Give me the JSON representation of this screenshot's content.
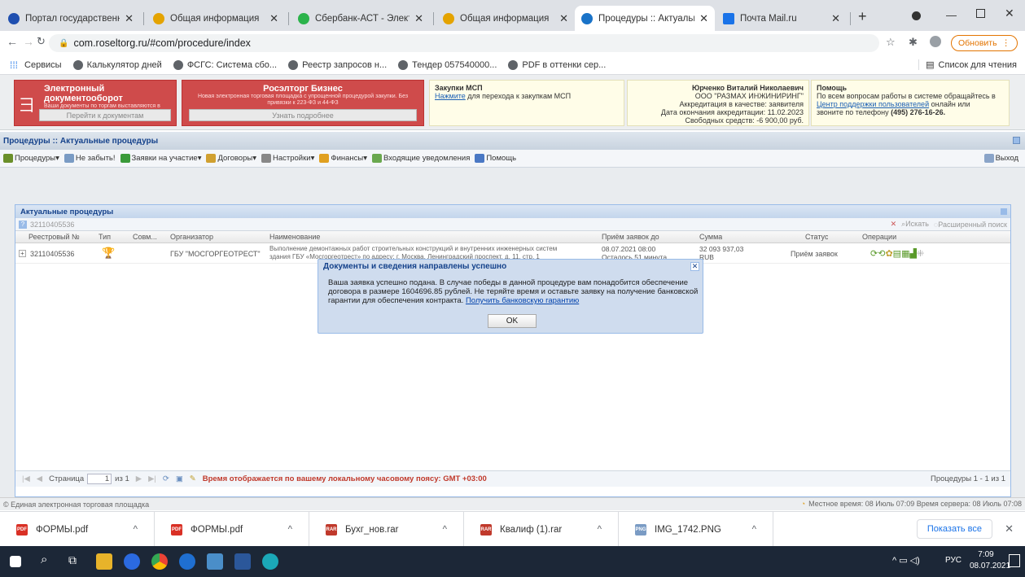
{
  "tabs": [
    {
      "title": "Портал государственных у",
      "color": "#1f4fb0",
      "active": false
    },
    {
      "title": "Общая информация",
      "color": "#e4a300",
      "active": false
    },
    {
      "title": "Сбербанк-АСТ - Электрон",
      "color": "#2bb34b",
      "active": false
    },
    {
      "title": "Общая информация",
      "color": "#e4a300",
      "active": false
    },
    {
      "title": "Процедуры :: Актуальные",
      "color": "#1a73c8",
      "active": true
    },
    {
      "title": "Почта Mail.ru",
      "color": "#1a73e8",
      "active": false
    }
  ],
  "browser": {
    "url": "com.roseltorg.ru/#com/procedure/index",
    "update_btn": "Обновить",
    "new_tab": "+"
  },
  "bookmarks": [
    "Сервисы",
    "Калькулятор дней",
    "ФСГС: Система сбо...",
    "Реестр запросов н...",
    "Тендер 057540000...",
    "PDF в оттенки сер..."
  ],
  "reading_list": "Список для чтения",
  "header": {
    "edo": {
      "title": "Электронный документооборот",
      "sub": "Ваши документы по торгам выставляются в электронном виде",
      "btn": "Перейти к документам"
    },
    "biz": {
      "title": "Росэлторг Бизнес",
      "sub": "Новая электронная торговая площадка с упрощенной процедурой закупки. Без привязки к 223-ФЗ и 44-ФЗ",
      "btn": "Узнать подробнее"
    },
    "msp": {
      "title": "Закупки МСП",
      "link": "Нажмите",
      "text": "для перехода к закупкам МСП"
    },
    "user": {
      "name": "Юрченко Виталий Николаевич",
      "org": "ООО \"РАЗМАХ ИНЖИНИРИНГ\"",
      "accr": "Аккредитация в качестве: заявителя",
      "end": "Дата окончания аккредитации: 11.02.2023",
      "funds": "Свободных средств: -6 900,00 руб."
    },
    "help": {
      "title": "Помощь",
      "l1": "По всем вопросам работы в системе обращайтесь в",
      "link": "Центр поддержки пользователей",
      "l2": "онлайн или",
      "l3": "звоните по телефону",
      "phone": "(495) 276-16-26."
    }
  },
  "breadcrumb": "Процедуры :: Актуальные процедуры",
  "menu": [
    {
      "label": "Процедуры",
      "color": "#6a8f2a"
    },
    {
      "label": "Не забыть!",
      "color": "#7a9bc4"
    },
    {
      "label": "Заявки на участие",
      "color": "#3a9a3a"
    },
    {
      "label": "Договоры",
      "color": "#d0a030"
    },
    {
      "label": "Настройки",
      "color": "#888"
    },
    {
      "label": "Финансы",
      "color": "#e0a020"
    },
    {
      "label": "Входящие уведомления",
      "color": "#6aa84f"
    },
    {
      "label": "Помощь",
      "color": "#4a78c4"
    }
  ],
  "exit": "Выход",
  "panel": {
    "title": "Актуальные процедуры",
    "search_value": "32110405536",
    "search_btn": "Искать",
    "adv_search": "Расширенный поиск",
    "columns": [
      "Реестровый №",
      "Тип",
      "Совм...",
      "Организатор",
      "Наименование",
      "Приём заявок до",
      "Сумма",
      "Статус",
      "Операции"
    ],
    "row": {
      "num": "32110405536",
      "org": "ГБУ \"МОСГОРГЕОТРЕСТ\"",
      "name1": "Выполнение демонтажных работ строительных конструкций и внутренних инженерных систем",
      "name2": "здания ГБУ «Мосгоргеотрест» по адресу: г. Москва, Ленинградский проспект, д. 11, стр. 1",
      "date": "08.07.2021 08:00",
      "left": "Осталось 51 минута",
      "sum": "32 093 937,03",
      "cur": "RUB",
      "status": "Приём заявок"
    },
    "footer": {
      "page_label": "Страница",
      "page": "1",
      "of": "из 1",
      "tz": "Время отображается по вашему локальному часовому поясу: GMT +03:00",
      "count": "Процедуры 1 - 1 из 1"
    }
  },
  "status": {
    "left": "© Единая электронная торговая площадка",
    "right": "Местное время: 08 Июль 07:09 Время сервера: 08 Июль 07:08"
  },
  "dialog": {
    "title": "Документы и сведения направлены успешно",
    "body": "Ваша заявка успешно подана. В случае победы в данной процедуре вам понадобится обеспечение договора в размере 1604696.85 рублей. Не теряйте время и оставьте заявку на получение банковской гарантии для обеспечения контракта.",
    "link": "Получить банковскую гарантию",
    "ok": "OK"
  },
  "downloads": [
    "ФОРМЫ.pdf",
    "ФОРМЫ.pdf",
    "Бухг_нов.rar",
    "Квалиф (1).rar",
    "IMG_1742.PNG"
  ],
  "show_all": "Показать все",
  "taskbar": {
    "lang": "РУС",
    "time": "7:09",
    "date": "08.07.2021"
  }
}
